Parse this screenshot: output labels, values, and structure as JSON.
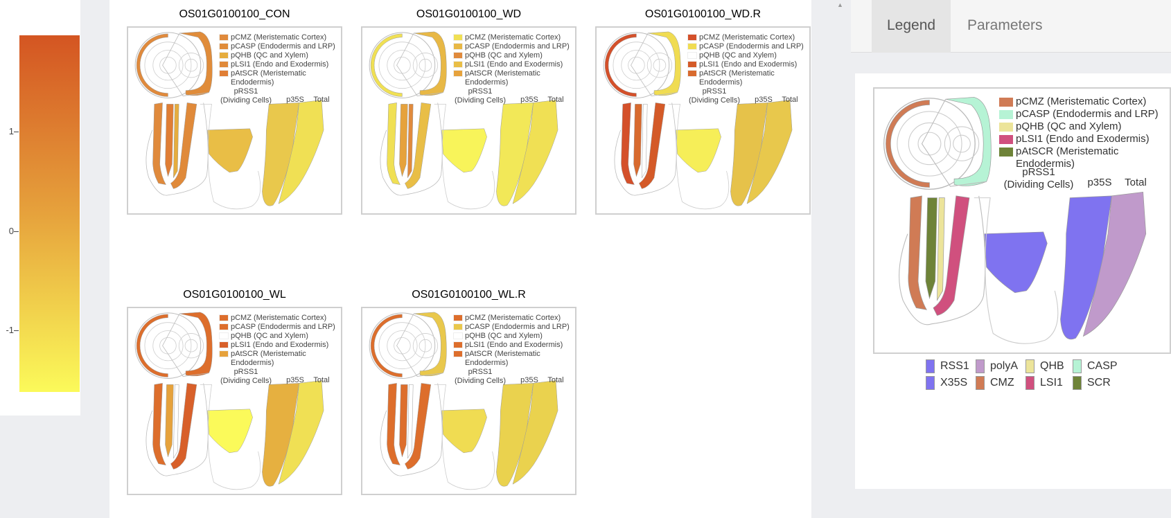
{
  "scale": {
    "ticks": [
      {
        "label": "1"
      },
      {
        "label": "0"
      },
      {
        "label": "-1"
      }
    ]
  },
  "legend_labels": {
    "cmz": "pCMZ (Meristematic Cortex)",
    "casp": "pCASP (Endodermis and LRP)",
    "qhb": "pQHB (QC and Xylem)",
    "lsi1": "pLSI1 (Endo and Exodermis)",
    "scr": "pAtSCR (Meristematic Endodermis)",
    "scr_l1": "pAtSCR (Meristematic",
    "scr_l2": "Endodermis)",
    "rss1_l1": "pRSS1",
    "rss1_l2": "(Dividing Cells)",
    "p35s": "p35S",
    "total": "Total"
  },
  "panels": [
    {
      "title": "OS01G0100100_CON",
      "colors": {
        "cmz": "#e08a3c",
        "casp": "#e08c3a",
        "qhb": "#e6ad3e",
        "lsi1": "#e08a3a",
        "scr": "#e07e35",
        "rss1": "#e9be46",
        "p35s": "#e9c84c",
        "total": "#f0e054"
      }
    },
    {
      "title": "OS01G0100100_WD",
      "colors": {
        "cmz": "#f0e054",
        "casp": "#e8b845",
        "qhb": "#e08a3c",
        "lsi1": "#e9be46",
        "scr": "#e6a23c",
        "rss1": "#f8f45a",
        "p35s": "#f2e858",
        "total": "#f0e054"
      }
    },
    {
      "title": "OS01G0100100_WD.R",
      "colors": {
        "cmz": "#d4502a",
        "casp": "#f0dc52",
        "qhb": "#ffffff",
        "lsi1": "#d45a28",
        "scr": "#d86a2e",
        "rss1": "#f6ee58",
        "p35s": "#e6c24a",
        "total": "#e8c84c"
      }
    },
    {
      "title": "OS01G0100100_WL",
      "colors": {
        "cmz": "#dd6e2c",
        "casp": "#dd6e2c",
        "qhb": "#ffffff",
        "lsi1": "#d8602a",
        "scr": "#e6a23c",
        "rss1": "#fbfa5a",
        "p35s": "#e6b040",
        "total": "#f0e054"
      }
    },
    {
      "title": "OS01G0100100_WL.R",
      "colors": {
        "cmz": "#dd6e2c",
        "casp": "#e9c84c",
        "qhb": "#ffffff",
        "lsi1": "#dd6e2c",
        "scr": "#dd6e2c",
        "rss1": "#f0dc52",
        "p35s": "#ead24e",
        "total": "#ead24e"
      }
    }
  ],
  "tabs": [
    {
      "label": "Legend",
      "active": true
    },
    {
      "label": "Parameters",
      "active": false
    }
  ],
  "legend_panel": {
    "colors": {
      "cmz": "#d07b55",
      "casp": "#b6f3d5",
      "qhb": "#ece49a",
      "lsi1": "#d0507e",
      "scr": "#6e8338",
      "rss1": "#7f73f0",
      "p35s": "#7f73f0",
      "total": "#c09acb"
    }
  },
  "key": [
    {
      "label": "RSS1",
      "color": "#7f73f0"
    },
    {
      "label": "X35S",
      "color": "#7f73f0"
    },
    {
      "label": "polyA",
      "color": "#c09acb"
    },
    {
      "label": "CMZ",
      "color": "#d07b55"
    },
    {
      "label": "QHB",
      "color": "#ece49a"
    },
    {
      "label": "LSI1",
      "color": "#d0507e"
    },
    {
      "label": "CASP",
      "color": "#b6f3d5"
    },
    {
      "label": "SCR",
      "color": "#6e8338"
    }
  ]
}
